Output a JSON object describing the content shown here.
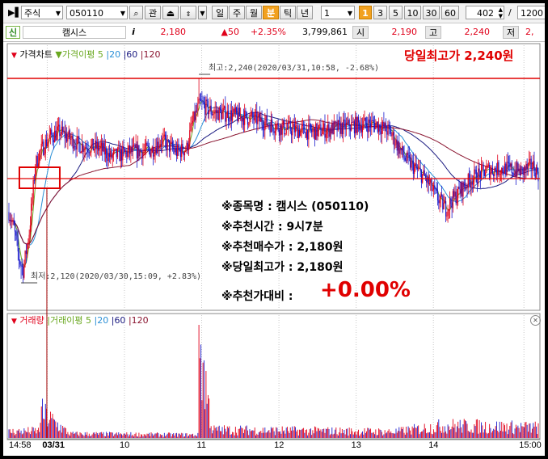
{
  "toolbar": {
    "market": "주식",
    "code": "050110",
    "type_btn": "관",
    "periods": [
      "일",
      "주",
      "월",
      "분",
      "틱",
      "년"
    ],
    "selected_period": "분",
    "minute_value": "1",
    "intervals": [
      "1",
      "3",
      "5",
      "10",
      "30",
      "60"
    ],
    "selected_interval": "1",
    "count": "402",
    "slash": "/",
    "total": "1200"
  },
  "quote": {
    "badge": "신",
    "name": "캠시스",
    "info": "i",
    "price": "2,180",
    "change": "▲50",
    "change_pct": "+2.35%",
    "volume": "3,799,861",
    "open_label": "시",
    "open": "2,190",
    "high_label": "고",
    "high": "2,240",
    "low_label": "저",
    "low": "2,"
  },
  "price_panel": {
    "legend": {
      "title": "가격차트",
      "ma_label": "가격이평",
      "periods": [
        "5",
        "20",
        "60",
        "120"
      ]
    },
    "banner": "당일최고가 2,240원",
    "high_note": "최고:2,240(2020/03/31,10:58, -2.68%)",
    "low_note": "최저:2,120(2020/03/30,15:09, +2.83%)",
    "info_box": {
      "line1": "※종목명 : 캠시스 (050110)",
      "line2": "※추천시간 : 9시7분",
      "line3": "※추천매수가 : 2,180원",
      "line4": "※당일최고가 : 2,180원",
      "line5_label": "※추천가대비 :",
      "line5_value": "+0.00%"
    }
  },
  "volume_panel": {
    "legend": {
      "title": "거래량",
      "ma_label": "거래이평",
      "periods": [
        "5",
        "20",
        "60",
        "120"
      ]
    }
  },
  "colors": {
    "up": "#e0001a",
    "down": "#1a1acc",
    "ma5": "#6aa820",
    "ma20": "#2a8fd6",
    "ma60": "#1a1a80",
    "ma120": "#8a1530",
    "highlight": "#e00000"
  },
  "chart_data": {
    "type": "candlestick",
    "x_labels": [
      "14:58",
      "03/31",
      "10",
      "11",
      "12",
      "13",
      "14",
      "15:00"
    ],
    "price_anchors": [
      {
        "i": 0,
        "price": 2160
      },
      {
        "i": 5,
        "price": 2150
      },
      {
        "i": 10,
        "price": 2132
      },
      {
        "i": 14,
        "price": 2125
      },
      {
        "i": 20,
        "price": 2148
      },
      {
        "i": 26,
        "price": 2188
      },
      {
        "i": 30,
        "price": 2195
      },
      {
        "i": 40,
        "price": 2205
      },
      {
        "i": 50,
        "price": 2208
      },
      {
        "i": 70,
        "price": 2200
      },
      {
        "i": 90,
        "price": 2198
      },
      {
        "i": 100,
        "price": 2193
      },
      {
        "i": 120,
        "price": 2196
      },
      {
        "i": 140,
        "price": 2197
      },
      {
        "i": 150,
        "price": 2203
      },
      {
        "i": 165,
        "price": 2196
      },
      {
        "i": 175,
        "price": 2198
      },
      {
        "i": 180,
        "price": 2212
      },
      {
        "i": 188,
        "price": 2225
      },
      {
        "i": 200,
        "price": 2220
      },
      {
        "i": 220,
        "price": 2218
      },
      {
        "i": 240,
        "price": 2216
      },
      {
        "i": 270,
        "price": 2210
      },
      {
        "i": 300,
        "price": 2208
      },
      {
        "i": 320,
        "price": 2210
      },
      {
        "i": 340,
        "price": 2212
      },
      {
        "i": 360,
        "price": 2213
      },
      {
        "i": 375,
        "price": 2208
      },
      {
        "i": 390,
        "price": 2192
      },
      {
        "i": 410,
        "price": 2180
      },
      {
        "i": 420,
        "price": 2170
      },
      {
        "i": 430,
        "price": 2162
      },
      {
        "i": 440,
        "price": 2170
      },
      {
        "i": 455,
        "price": 2180
      },
      {
        "i": 470,
        "price": 2185
      },
      {
        "i": 490,
        "price": 2186
      },
      {
        "i": 505,
        "price": 2184
      },
      {
        "i": 515,
        "price": 2188
      },
      {
        "i": 521,
        "price": 2183
      }
    ],
    "num_candles": 522,
    "y_range": [
      2105,
      2255
    ],
    "session_high": 2240,
    "session_low": 2120,
    "recommend_price": 2180,
    "volume_anchors": [
      {
        "i": 0,
        "v": 0.06
      },
      {
        "i": 30,
        "v": 0.07
      },
      {
        "i": 31,
        "v": 0.25
      },
      {
        "i": 60,
        "v": 0.04
      },
      {
        "i": 186,
        "v": 0.03
      },
      {
        "i": 187,
        "v": 1.0
      },
      {
        "i": 200,
        "v": 0.08
      },
      {
        "i": 380,
        "v": 0.06
      },
      {
        "i": 430,
        "v": 0.12
      },
      {
        "i": 521,
        "v": 0.1
      }
    ]
  }
}
